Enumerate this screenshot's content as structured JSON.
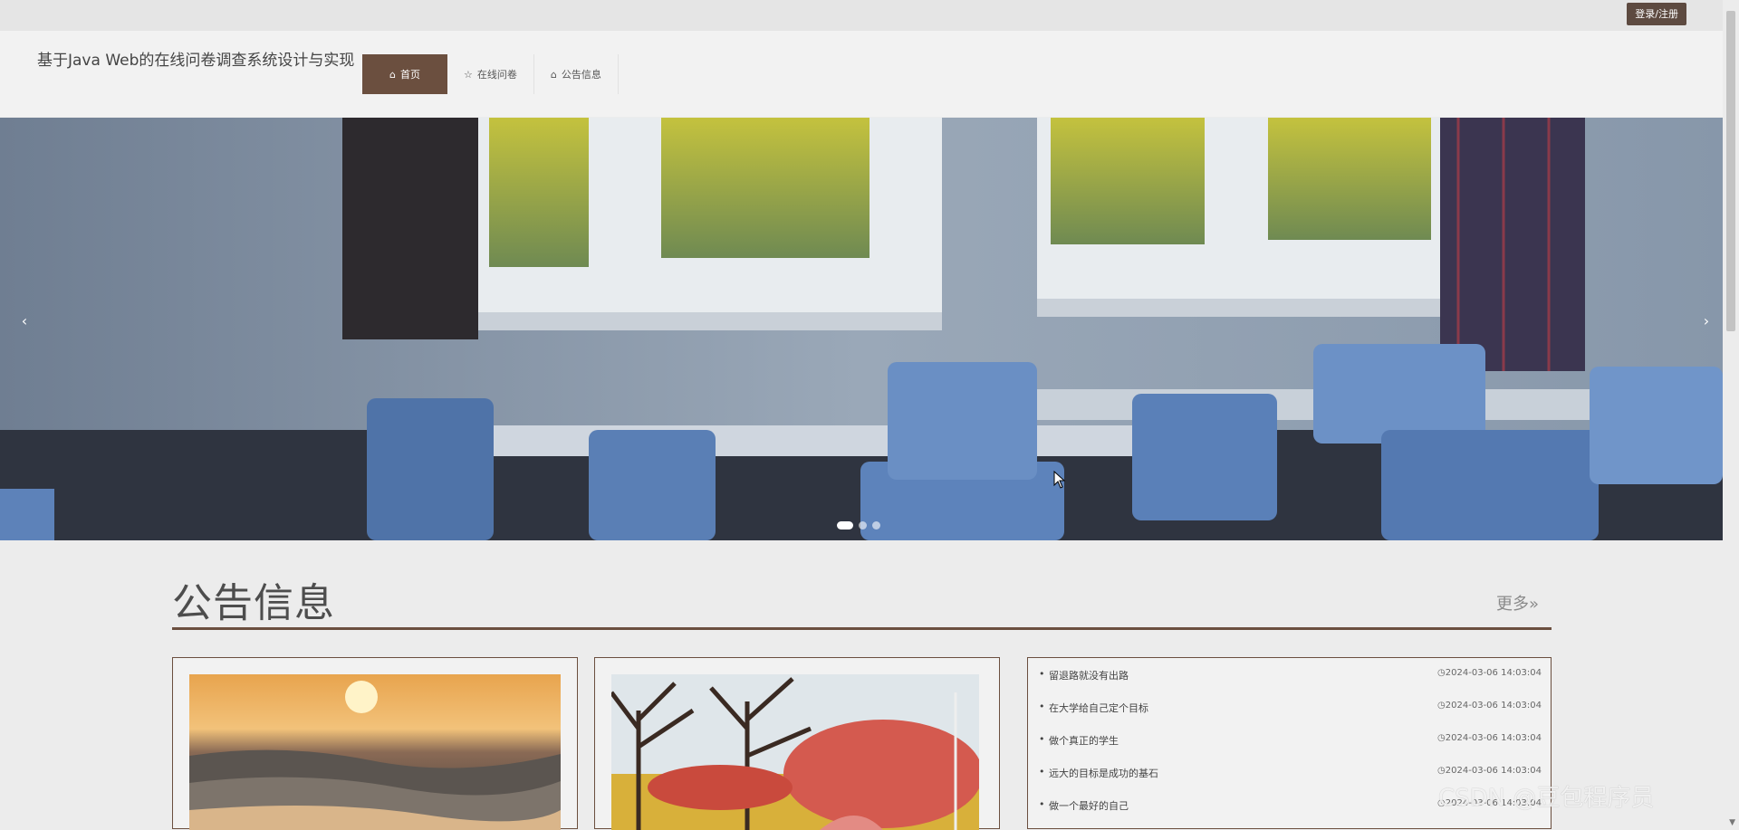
{
  "topbar": {
    "login_label": "登录/注册"
  },
  "header": {
    "site_title": "基于Java Web的在线问卷调查系统设计与实现",
    "nav": [
      {
        "label": "首页",
        "icon": "home-icon",
        "active": true
      },
      {
        "label": "在线问卷",
        "icon": "star-icon",
        "active": false
      },
      {
        "label": "公告信息",
        "icon": "bag-icon",
        "active": false
      }
    ]
  },
  "banner": {
    "prev_label": "‹",
    "next_label": "›",
    "slide_count": 3,
    "active_slide": 1
  },
  "notice": {
    "title": "公告信息",
    "more_label": "更多»",
    "items": [
      {
        "title": "留退路就没有出路",
        "date": "2024-03-06 14:03:04"
      },
      {
        "title": "在大学给自己定个目标",
        "date": "2024-03-06 14:03:04"
      },
      {
        "title": "做个真正的学生",
        "date": "2024-03-06 14:03:04"
      },
      {
        "title": "远大的目标是成功的基石",
        "date": "2024-03-06 14:03:04"
      },
      {
        "title": "做一个最好的自己",
        "date": "2024-03-06 14:03:04"
      }
    ]
  },
  "watermark": "CSDN @豆包程序员",
  "colors": {
    "accent": "#6b4f3f",
    "login_bg": "#5d4a40"
  }
}
